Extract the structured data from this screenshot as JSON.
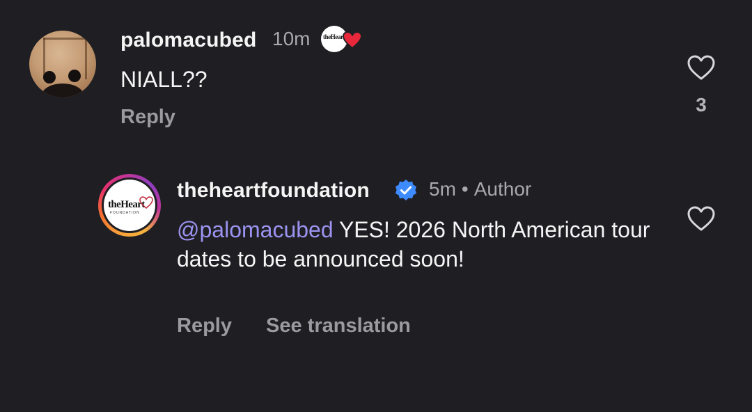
{
  "comments": [
    {
      "username": "palomacubed",
      "time": "10m",
      "text": "NIALL??",
      "reply_label": "Reply",
      "like_count": "3",
      "avatar_icon": "user-photo",
      "badge_icon": "heart-foundation-logo"
    },
    {
      "username": "theheartfoundation",
      "time": "5m",
      "author_label": "Author",
      "dot": "•",
      "mention": "@palomacubed",
      "text": "YES! 2026 North American tour dates to be announced soon!",
      "reply_label": "Reply",
      "translate_label": "See translation",
      "verified_icon": "verified-badge-icon",
      "avatar_icon": "heart-foundation-logo"
    }
  ],
  "colors": {
    "background": "#1f1f23",
    "primary_text": "#f5f5f5",
    "secondary_text": "#a9a9ad",
    "mention": "#9b93f0",
    "verified": "#3e8bff",
    "heart_badge": "#e8283a"
  }
}
